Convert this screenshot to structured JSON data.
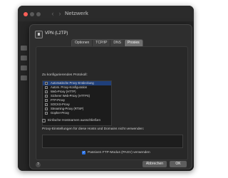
{
  "window": {
    "title": "Netzwerk"
  },
  "dialog": {
    "service_name": "VPN (L2TP)",
    "tabs": [
      {
        "label": "Optionen",
        "active": false
      },
      {
        "label": "TCP/IP",
        "active": false
      },
      {
        "label": "DNS",
        "active": false
      },
      {
        "label": "Proxies",
        "active": true
      }
    ],
    "protocols_label": "Zu konfigurierendes Protokoll:",
    "protocols": [
      {
        "label": "Automatische Proxy-Entdeckung",
        "selected": true
      },
      {
        "label": "Autom. Proxy-Konfiguration",
        "selected": false
      },
      {
        "label": "Web-Proxy (HTTP)",
        "selected": false
      },
      {
        "label": "Sicherer Web-Proxy (HTTPS)",
        "selected": false
      },
      {
        "label": "FTP-Proxy",
        "selected": false
      },
      {
        "label": "SOCKS-Proxy",
        "selected": false
      },
      {
        "label": "Streaming-Proxy (RTSP)",
        "selected": false
      },
      {
        "label": "Gopher-Proxy",
        "selected": false
      }
    ],
    "exclude_simple_hostnames": "Einfache Hostnamen ausschließen",
    "bypass_label": "Proxy-Einstellungen für diese Hosts und Domains nicht verwenden:",
    "bypass_value": "",
    "passive_ftp": {
      "label": "Passiven FTP-Modus (PASV) verwenden",
      "checked": true
    },
    "cancel_label": "Abbrechen",
    "ok_label": "OK",
    "help_label": "?"
  },
  "accent_color": "#2b73e6"
}
